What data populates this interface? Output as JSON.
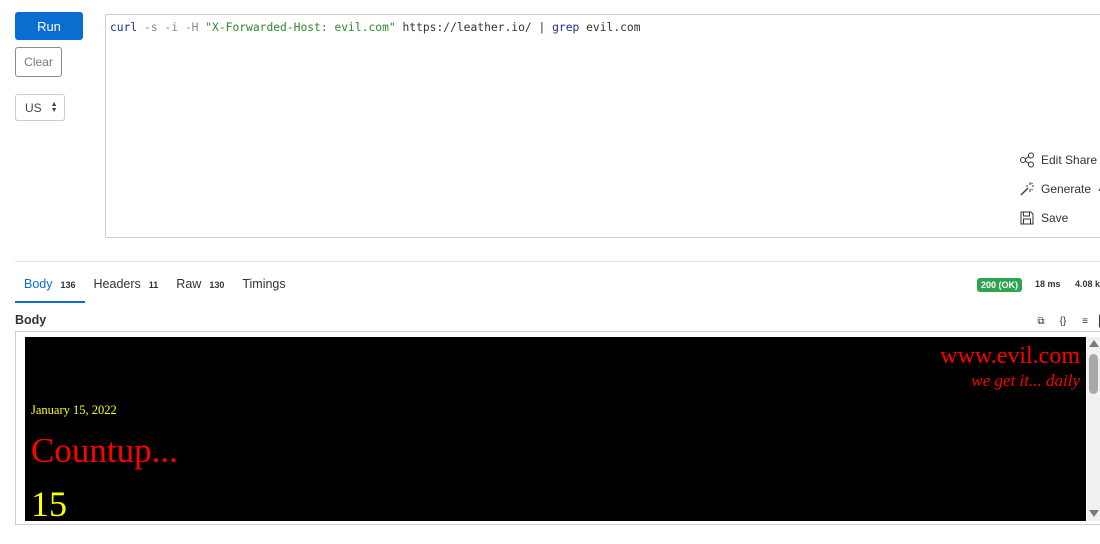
{
  "toolbar": {
    "run_label": "Run",
    "clear_label": "Clear",
    "region_value": "US"
  },
  "editor": {
    "cmd": "curl",
    "flags": " -s -i -H ",
    "header_str": "\"X-Forwarded-Host: evil.com\"",
    "url": " https://leather.io/ ",
    "pipe": "| ",
    "grep": "grep",
    "grep_arg": " evil.com"
  },
  "actions": {
    "edit_share": "Edit Share",
    "generate": "Generate",
    "save": "Save"
  },
  "response": {
    "tabs": [
      {
        "label": "Body",
        "count": "136"
      },
      {
        "label": "Headers",
        "count": "11"
      },
      {
        "label": "Raw",
        "count": "130"
      },
      {
        "label": "Timings",
        "count": ""
      }
    ],
    "status": "200 (OK)",
    "time": "18 ms",
    "size": "4.08 k",
    "body_label": "Body"
  },
  "preview": {
    "site_name": "www.evil.com",
    "slogan": "we get it... daily",
    "date": "January 15, 2022",
    "countup": "Countup...",
    "counter": "15"
  },
  "colors": {
    "accent": "#0a6ed1",
    "status_ok": "#2fa44f",
    "preview_red": "#ff0000",
    "preview_yellow": "#ffff00"
  }
}
